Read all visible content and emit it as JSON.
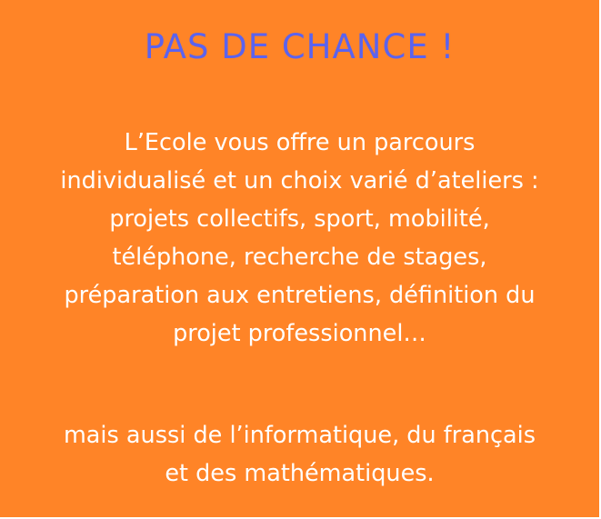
{
  "title": "PAS DE CHANCE !",
  "paragraph1": {
    "lines": [
      "L’Ecole vous offre un parcours",
      "individualisé et un choix varié d’ateliers :",
      "projets collectifs, sport, mobilité,",
      "téléphone, recherche de stages,",
      "préparation aux entretiens, définition du",
      "projet professionnel…"
    ]
  },
  "paragraph2": {
    "lines": [
      "mais aussi de l’informatique, du français",
      "et des mathématiques."
    ]
  },
  "colors": {
    "background": "#ff8427",
    "title": "#5b63ee",
    "text": "#ffffff"
  }
}
